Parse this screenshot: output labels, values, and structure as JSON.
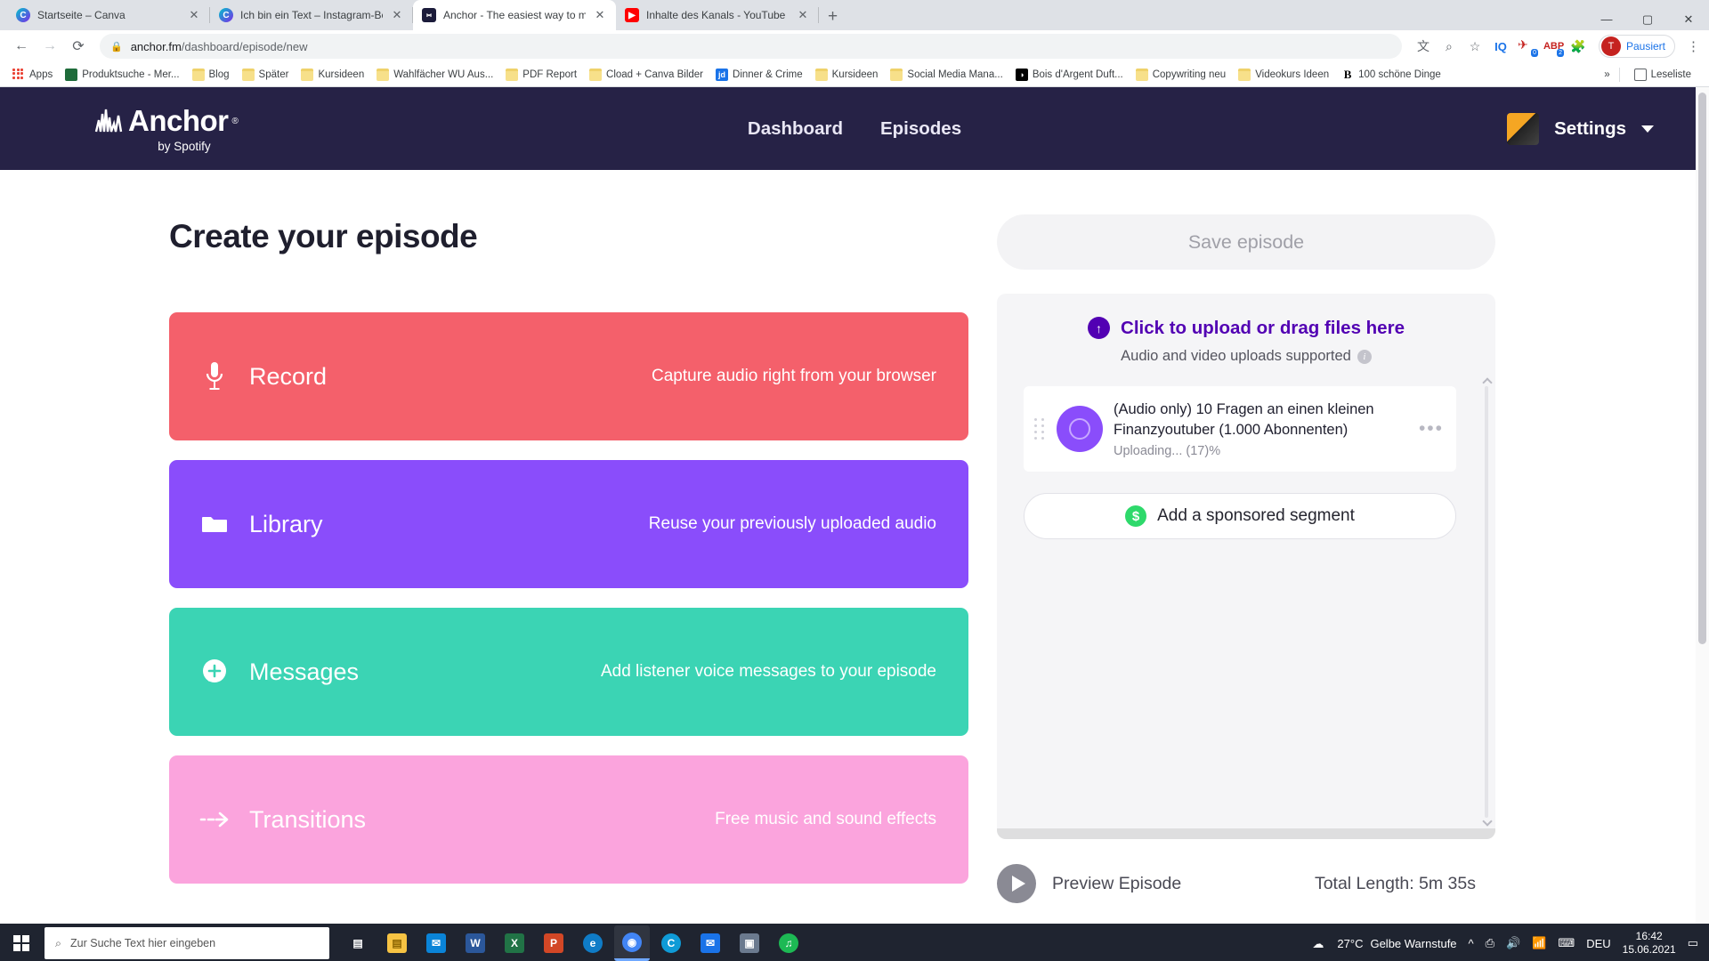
{
  "browser": {
    "tabs": [
      {
        "title": "Startseite – Canva",
        "favicon": "canva-icon",
        "active": false
      },
      {
        "title": "Ich bin ein Text – Instagram-Beitr",
        "favicon": "canva-icon",
        "active": false
      },
      {
        "title": "Anchor - The easiest way to mak",
        "favicon": "anchor-icon",
        "active": true
      },
      {
        "title": "Inhalte des Kanals - YouTube Stu",
        "favicon": "youtube-icon",
        "active": false
      }
    ],
    "new_tab_label": "+",
    "window_controls": {
      "minimize": "—",
      "maximize": "▢",
      "close": "✕"
    },
    "nav": {
      "back": "←",
      "forward": "→",
      "reload": "⟳"
    },
    "address": {
      "host": "anchor.fm",
      "path": "/dashboard/episode/new",
      "lock": "🔒"
    },
    "toolbar_icons": [
      {
        "name": "translate-icon",
        "glyph": "文"
      },
      {
        "name": "zoom-icon",
        "glyph": "⌕"
      },
      {
        "name": "bookmark-star-icon",
        "glyph": "☆"
      }
    ],
    "extensions": [
      {
        "name": "iq-extension-icon",
        "label": "IQ"
      },
      {
        "name": "mail-extension-icon",
        "label": "✈",
        "badge": "0"
      },
      {
        "name": "abp-extension-icon",
        "label": "ABP",
        "badge": "2"
      },
      {
        "name": "puzzle-extensions-icon",
        "label": "🧩"
      }
    ],
    "profile": {
      "initial": "T",
      "label": "Pausiert"
    },
    "menu_icon": "⋮",
    "bookmarks": [
      {
        "label": "Apps",
        "icon": "apps-grid-icon"
      },
      {
        "label": "Produktsuche - Mer...",
        "icon": "image-icon"
      },
      {
        "label": "Blog",
        "icon": "folder-icon"
      },
      {
        "label": "Später",
        "icon": "folder-icon"
      },
      {
        "label": "Kursideen",
        "icon": "folder-icon"
      },
      {
        "label": "Wahlfächer WU Aus...",
        "icon": "folder-icon"
      },
      {
        "label": "PDF Report",
        "icon": "folder-icon"
      },
      {
        "label": "Cload + Canva Bilder",
        "icon": "folder-icon"
      },
      {
        "label": "Dinner & Crime",
        "icon": "jd-icon"
      },
      {
        "label": "Kursideen",
        "icon": "folder-icon"
      },
      {
        "label": "Social Media Mana...",
        "icon": "folder-icon"
      },
      {
        "label": "Bois d'Argent Duft...",
        "icon": "dark-icon"
      },
      {
        "label": "Copywriting neu",
        "icon": "folder-icon"
      },
      {
        "label": "Videokurs Ideen",
        "icon": "folder-icon"
      },
      {
        "label": "100 schöne Dinge",
        "icon": "b-icon"
      }
    ],
    "bookmarks_overflow": "»",
    "reading_list": "Leseliste"
  },
  "app": {
    "logo": {
      "name": "Anchor",
      "registered": "®",
      "subtitle": "by Spotify"
    },
    "nav": [
      {
        "label": "Dashboard"
      },
      {
        "label": "Episodes"
      }
    ],
    "settings_label": "Settings",
    "page_title": "Create your episode",
    "cards": [
      {
        "title": "Record",
        "desc": "Capture audio right from your browser",
        "icon": "microphone-icon",
        "color": "#f4606b"
      },
      {
        "title": "Library",
        "desc": "Reuse your previously uploaded audio",
        "icon": "folder-icon",
        "color": "#8a4dfb"
      },
      {
        "title": "Messages",
        "desc": "Add listener voice messages to your episode",
        "icon": "message-plus-icon",
        "color": "#3bd4b4"
      },
      {
        "title": "Transitions",
        "desc": "Free music and sound effects",
        "icon": "arrow-right-icon",
        "color": "#fba4dd"
      }
    ],
    "save_button": "Save episode",
    "upload": {
      "cta": "Click to upload or drag files here",
      "subtitle": "Audio and video uploads supported",
      "info_icon": "i",
      "arrow_icon": "↑"
    },
    "tracks": [
      {
        "name": "(Audio only) 10 Fragen an einen kleinen Finanzyoutuber (1.000 Abonnenten)",
        "status": "Uploading... (17)%",
        "more_icon": "•••"
      }
    ],
    "sponsored_button": "Add a sponsored segment",
    "sponsored_icon": "$",
    "preview_label": "Preview Episode",
    "total_length": "Total Length: 5m 35s"
  },
  "taskbar": {
    "search_placeholder": "Zur Suche Text hier eingeben",
    "apps": [
      {
        "name": "task-view-icon",
        "label": "▤",
        "color": "#1f2430"
      },
      {
        "name": "file-explorer-icon",
        "label": "📁",
        "color": "#f6c343"
      },
      {
        "name": "mail-icon",
        "label": "✉",
        "color": "#0a84d8"
      },
      {
        "name": "word-icon",
        "label": "W",
        "color": "#2b579a"
      },
      {
        "name": "excel-icon",
        "label": "X",
        "color": "#217346"
      },
      {
        "name": "powerpoint-icon",
        "label": "P",
        "color": "#d24726"
      },
      {
        "name": "edge-legacy-icon",
        "label": "e",
        "color": "#0f7cc7"
      },
      {
        "name": "chrome-icon",
        "label": "◉",
        "color": "#4285f4"
      },
      {
        "name": "edge-icon",
        "label": "C",
        "color": "#0f9bd7"
      },
      {
        "name": "mail2-icon",
        "label": "✉",
        "color": "#1a73e8"
      },
      {
        "name": "app-icon",
        "label": "▣",
        "color": "#6b7a8f"
      },
      {
        "name": "spotify-icon",
        "label": "♫",
        "color": "#1db954"
      }
    ],
    "weather": {
      "temp": "27°C",
      "text": "Gelbe Warnstufe"
    },
    "tray_icons": [
      "^",
      "camera",
      "volume",
      "wifi",
      "keyboard"
    ],
    "language": "DEU",
    "time": "16:42",
    "date": "15.06.2021",
    "notification_icon": "▭"
  }
}
